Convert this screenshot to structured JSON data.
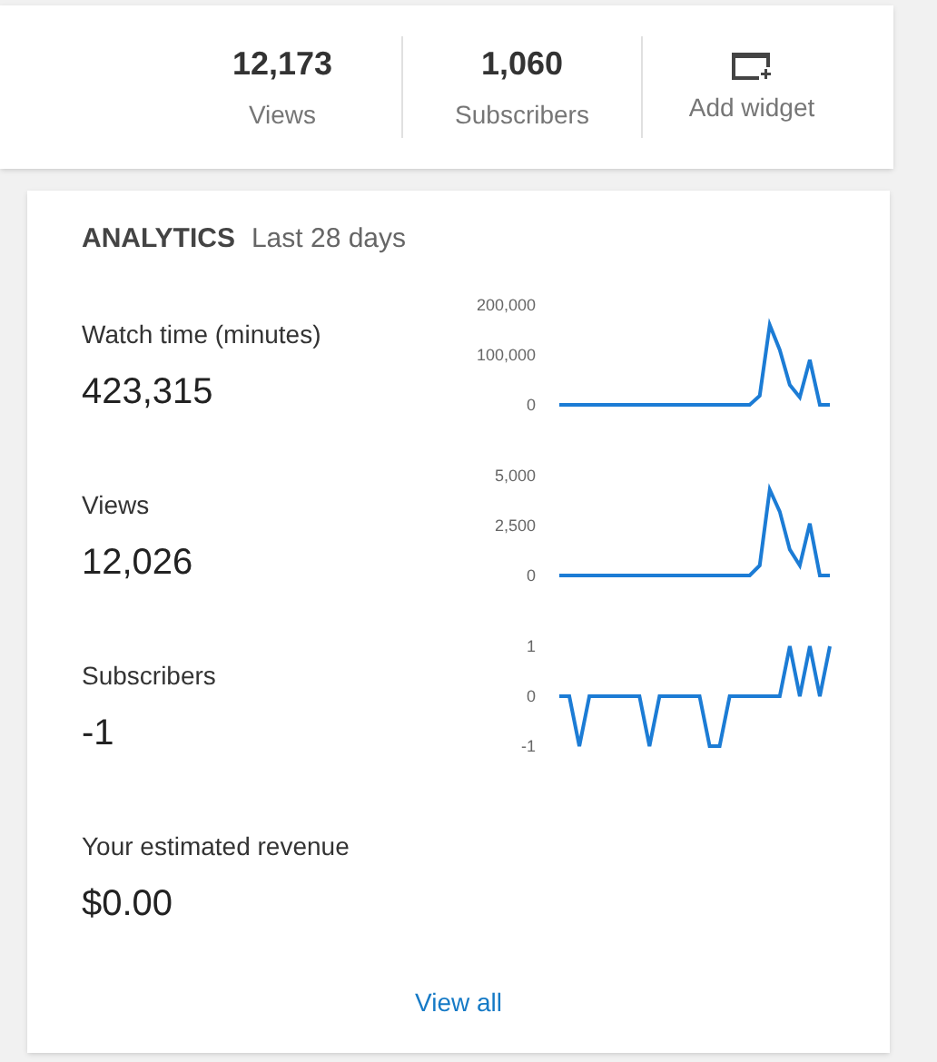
{
  "header_stats": [
    {
      "value": "12,173",
      "label": "Views"
    },
    {
      "value": "1,060",
      "label": "Subscribers"
    }
  ],
  "add_widget": {
    "label": "Add widget"
  },
  "analytics": {
    "title": "ANALYTICS",
    "period": "Last 28 days",
    "metrics": [
      {
        "label": "Watch time (minutes)",
        "value": "423,315",
        "chart_data": {
          "type": "line",
          "ylim": [
            0,
            200000
          ],
          "yticks": [
            {
              "value": 0,
              "label": "0"
            },
            {
              "value": 100000,
              "label": "100,000"
            },
            {
              "value": 200000,
              "label": "200,000"
            }
          ],
          "series": [
            {
              "color": "#1c7cd5",
              "values": [
                0,
                0,
                0,
                0,
                0,
                0,
                0,
                0,
                0,
                0,
                0,
                0,
                0,
                0,
                0,
                0,
                0,
                0,
                0,
                0,
                18000,
                160000,
                110000,
                40000,
                15000,
                90000,
                0,
                0
              ]
            }
          ]
        }
      },
      {
        "label": "Views",
        "value": "12,026",
        "chart_data": {
          "type": "line",
          "ylim": [
            0,
            5000
          ],
          "yticks": [
            {
              "value": 0,
              "label": "0"
            },
            {
              "value": 2500,
              "label": "2,500"
            },
            {
              "value": 5000,
              "label": "5,000"
            }
          ],
          "series": [
            {
              "color": "#1c7cd5",
              "values": [
                0,
                0,
                0,
                0,
                0,
                0,
                0,
                0,
                0,
                0,
                0,
                0,
                0,
                0,
                0,
                0,
                0,
                0,
                0,
                0,
                500,
                4300,
                3200,
                1300,
                500,
                2600,
                0,
                0
              ]
            }
          ]
        }
      },
      {
        "label": "Subscribers",
        "value": "-1",
        "chart_data": {
          "type": "line",
          "ylim": [
            -1,
            1
          ],
          "yticks": [
            {
              "value": -1,
              "label": "-1"
            },
            {
              "value": 0,
              "label": "0"
            },
            {
              "value": 1,
              "label": "1"
            }
          ],
          "series": [
            {
              "color": "#1c7cd5",
              "values": [
                0,
                0,
                -1,
                0,
                0,
                0,
                0,
                0,
                0,
                -1,
                0,
                0,
                0,
                0,
                0,
                -1,
                -1,
                0,
                0,
                0,
                0,
                0,
                0,
                1,
                0,
                1,
                0,
                1
              ]
            }
          ]
        }
      },
      {
        "label": "Your estimated revenue",
        "value": "$0.00"
      }
    ],
    "view_all": "View all"
  }
}
